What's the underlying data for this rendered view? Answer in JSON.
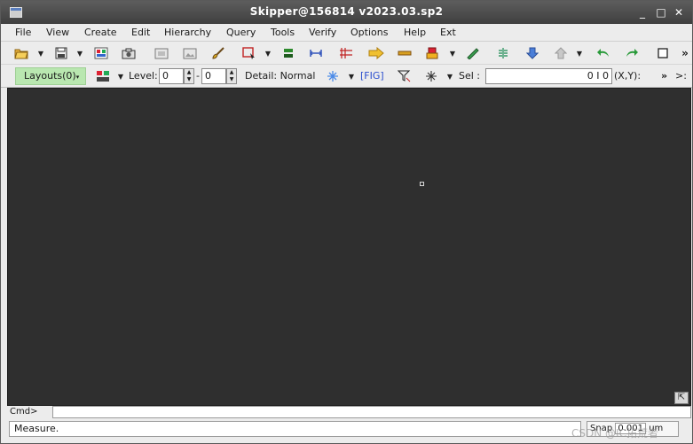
{
  "window": {
    "title": "Skipper@156814 v2023.03.sp2",
    "minimize": "_",
    "maximize": "□",
    "close": "✕"
  },
  "menu": [
    "File",
    "View",
    "Create",
    "Edit",
    "Hierarchy",
    "Query",
    "Tools",
    "Verify",
    "Options",
    "Help",
    "Ext"
  ],
  "toolbar1": {
    "overflow": "»"
  },
  "toolbar2": {
    "layouts_label": "Layouts(0)",
    "level_label": "Level:",
    "level_from": "0",
    "level_sep": "-",
    "level_to": "0",
    "detail_label": "Detail: Normal",
    "fig_label": "[FIG]",
    "sel_label": "Sel :",
    "sel_value": "0 I 0",
    "xy_label": "(X,Y):",
    "overflow": "»",
    "more": ">:"
  },
  "cmd": {
    "label": "Cmd>"
  },
  "status": {
    "message": "Measure.",
    "snap_label": "Snap",
    "snap_value": "0.001",
    "snap_unit": "um",
    "watermark": "CSDN @IC拓荒者"
  },
  "colors": {
    "canvas_bg": "#2f2f2f",
    "layouts_bg": "#b9e7b0",
    "titlebar": "#4a4a4a"
  }
}
